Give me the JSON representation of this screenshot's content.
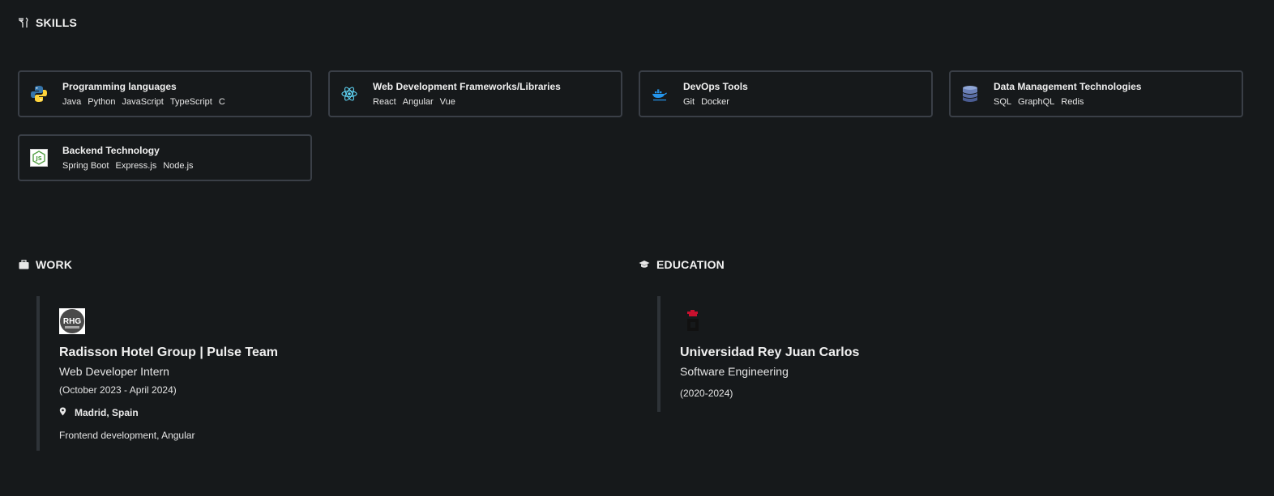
{
  "skills": {
    "title": "SKILLS",
    "icon": "tools-icon",
    "cards": [
      {
        "name": "Programming languages",
        "icon": "python-logo-icon",
        "tags": [
          "Java",
          "Python",
          "JavaScript",
          "TypeScript",
          "C"
        ]
      },
      {
        "name": "Web Development Frameworks/Libraries",
        "icon": "react-logo-icon",
        "tags": [
          "React",
          "Angular",
          "Vue"
        ]
      },
      {
        "name": "DevOps Tools",
        "icon": "docker-logo-icon",
        "tags": [
          "Git",
          "Docker"
        ]
      },
      {
        "name": "Data Management Technologies",
        "icon": "database-icon",
        "tags": [
          "SQL",
          "GraphQL",
          "Redis"
        ]
      },
      {
        "name": "Backend Technology",
        "icon": "nodejs-logo-icon",
        "tags": [
          "Spring Boot",
          "Express.js",
          "Node.js"
        ]
      }
    ]
  },
  "work": {
    "title": "WORK",
    "icon": "briefcase-icon",
    "entry": {
      "logo_text": "RHG",
      "company": "Radisson Hotel Group | Pulse Team",
      "role": "Web Developer Intern",
      "dates": "(October 2023 - April 2024)",
      "location": "Madrid, Spain",
      "description": "Frontend development, Angular"
    }
  },
  "education": {
    "title": "EDUCATION",
    "icon": "graduation-cap-icon",
    "entry": {
      "school": "Universidad Rey Juan Carlos",
      "degree": "Software Engineering",
      "dates": "(2020-2024)"
    }
  },
  "colors": {
    "background": "#16191b",
    "card_border": "#3a3f47",
    "timeline_line": "#2e3338",
    "react": "#61dafb",
    "docker": "#2496ed",
    "urjc_red": "#c8102e"
  }
}
